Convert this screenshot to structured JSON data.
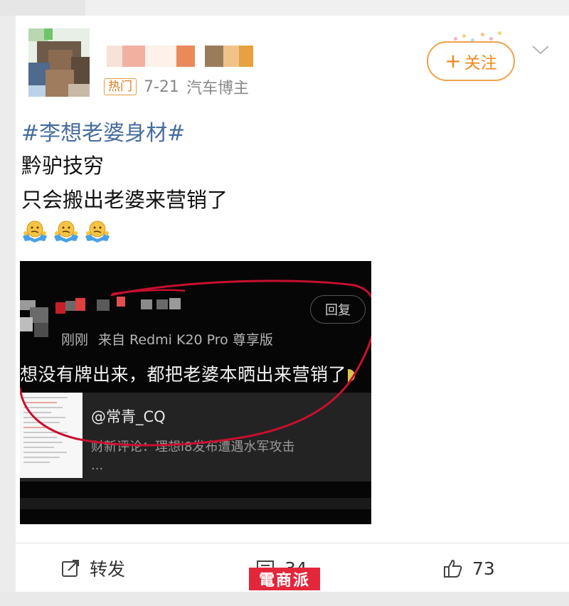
{
  "post": {
    "badge": "热门",
    "date": "7-21",
    "role": "汽车博主",
    "follow_icon": "+",
    "follow_label": "关注",
    "hashtag": "#李想老婆身材#",
    "text_line1": "黔驴技穷",
    "text_line2": "只会搬出老婆来营销了",
    "emoji_name": "shrug-emoji",
    "emoji_count": 3
  },
  "embedded": {
    "reply_label": "回复",
    "time": "刚刚",
    "source": "来自 Redmi K20 Pro 尊享版",
    "comment_text": "想没有牌出来，都把老婆本晒出来营销了",
    "quote_user": "@常青_CQ",
    "quote_desc": "财新评论：理想i8发布遭遇水军攻击",
    "quote_more": "..."
  },
  "actions": {
    "repost_label": "转发",
    "comment_count": "34",
    "like_count": "73"
  },
  "watermark": {
    "text": "電商派"
  },
  "colors": {
    "hashtag": "#466d9f",
    "follow": "#ee8a1c",
    "badge": "#e07b1c",
    "annotation_red": "#c8102e",
    "watermark_bg": "#e3263a"
  }
}
